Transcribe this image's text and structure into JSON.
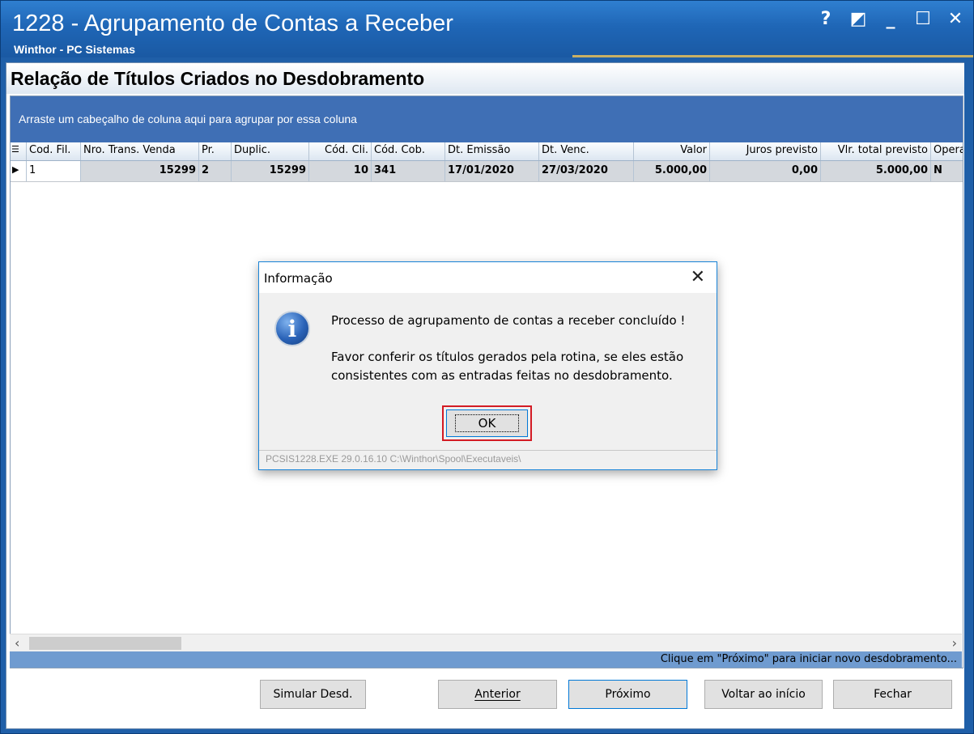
{
  "window": {
    "title": "1228 - Agrupamento de Contas a Receber",
    "subtitle": "Winthor - PC Sistemas",
    "controls": {
      "help": "?",
      "restore": "◩",
      "minimize": "_",
      "maximize": "☐",
      "close": "✕"
    }
  },
  "page": {
    "heading": "Relação de Títulos Criados no Desdobramento",
    "group_panel": "Arraste um cabeçalho de coluna aqui para agrupar por essa coluna"
  },
  "grid": {
    "columns": [
      "Cod. Fil.",
      "Nro. Trans. Venda",
      "Pr.",
      "Duplic.",
      "Cód. Cli.",
      "Cód. Cob.",
      "Dt. Emissão",
      "Dt. Venc.",
      "Valor",
      "Juros previsto",
      "Vlr. total previsto",
      "Opera"
    ],
    "rows": [
      [
        "1",
        "15299",
        "2",
        "15299",
        "10",
        "341",
        "17/01/2020",
        "27/03/2020",
        "5.000,00",
        "0,00",
        "5.000,00",
        "N"
      ]
    ]
  },
  "status": "Clique em \"Próximo\" para iniciar novo desdobramento...",
  "buttons": {
    "simular": "Simular Desd.",
    "anterior": "Anterior",
    "proximo": "Próximo",
    "voltar": "Voltar ao início",
    "fechar": "Fechar"
  },
  "dialog": {
    "title": "Informação",
    "message1": "Processo de agrupamento de contas a receber concluído !",
    "message2_line1": "Favor conferir os títulos gerados pela rotina, se eles estão",
    "message2_line2": "consistentes com as entradas feitas no desdobramento.",
    "ok": "OK",
    "footer": "PCSIS1228.EXE 29.0.16.10 C:\\Winthor\\Spool\\Executaveis\\"
  },
  "colors": {
    "title_bar": "#1f66b6",
    "group_panel": "#3f6fb5",
    "highlight": "#d31b24"
  }
}
